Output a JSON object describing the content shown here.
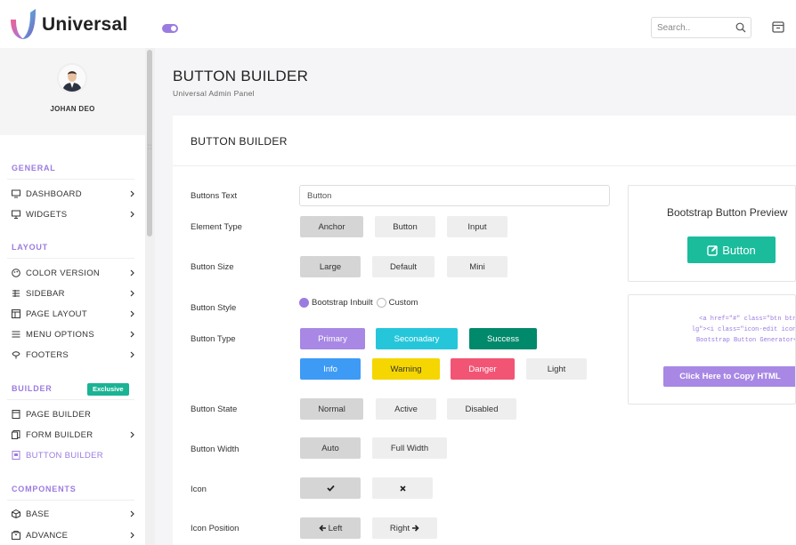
{
  "header": {
    "brand": "Universal",
    "search_placeholder": "Search..",
    "accent": "#9b7be0"
  },
  "sidebar": {
    "user_name": "JOHAN DEO",
    "sections": {
      "general": "GENERAL",
      "layout": "LAYOUT",
      "builder": "BUILDER",
      "components": "COMPONENTS"
    },
    "builder_badge": "Exclusive",
    "items": [
      {
        "label": "DASHBOARD",
        "icon": "monitor-icon"
      },
      {
        "label": "WIDGETS",
        "icon": "desktop-icon"
      },
      {
        "label": "COLOR VERSION",
        "icon": "palette-icon"
      },
      {
        "label": "SIDEBAR",
        "icon": "sidebar-icon"
      },
      {
        "label": "PAGE LAYOUT",
        "icon": "layout-icon"
      },
      {
        "label": "MENU OPTIONS",
        "icon": "menu-icon"
      },
      {
        "label": "FOOTERS",
        "icon": "footer-icon"
      },
      {
        "label": "PAGE BUILDER",
        "icon": "page-icon"
      },
      {
        "label": "FORM BUILDER",
        "icon": "form-icon"
      },
      {
        "label": "BUTTON BUILDER",
        "icon": "button-builder-icon"
      },
      {
        "label": "BASE",
        "icon": "cube-icon"
      },
      {
        "label": "ADVANCE",
        "icon": "box-icon"
      }
    ]
  },
  "page": {
    "title": "BUTTON BUILDER",
    "subtitle": "Universal Admin Panel",
    "card_title": "BUTTON BUILDER"
  },
  "form": {
    "labels": {
      "buttons_text": "Buttons Text",
      "element_type": "Element Type",
      "button_size": "Button Size",
      "button_style": "Button Style",
      "button_type": "Button Type",
      "button_state": "Button State",
      "button_width": "Button Width",
      "icon": "Icon",
      "icon_position": "Icon Position"
    },
    "buttons_text_value": "Button",
    "element_type": [
      "Anchor",
      "Button",
      "Input"
    ],
    "button_size": [
      "Large",
      "Default",
      "Mini"
    ],
    "button_style": [
      "Bootstrap Inbuilt",
      "Custom"
    ],
    "button_type": [
      {
        "label": "Primary",
        "color": "#a888e4"
      },
      {
        "label": "Seconadary",
        "color": "#26c6da"
      },
      {
        "label": "Success",
        "color": "#00896b"
      },
      {
        "label": "Info",
        "color": "#3d9bf5"
      },
      {
        "label": "Warning",
        "color": "#f5d600"
      },
      {
        "label": "Danger",
        "color": "#f25574"
      },
      {
        "label": "Light",
        "color": "#eeeeee"
      }
    ],
    "button_state": [
      "Normal",
      "Active",
      "Disabled"
    ],
    "button_width": [
      "Auto",
      "Full Width"
    ],
    "icon_position": [
      "Left",
      "Right"
    ]
  },
  "preview": {
    "title": "Bootstrap Button Preview",
    "button_label": "Button",
    "button_color": "#1abc9c",
    "code_line1": "<a href=\"#\" class=\"btn btn-success",
    "code_line2": "lg\"><i class=\"icon-edit icon-white\">",
    "code_line3": "Bootstrap Button Generator</a>",
    "copy_label": "Click Here to Copy HTML"
  }
}
